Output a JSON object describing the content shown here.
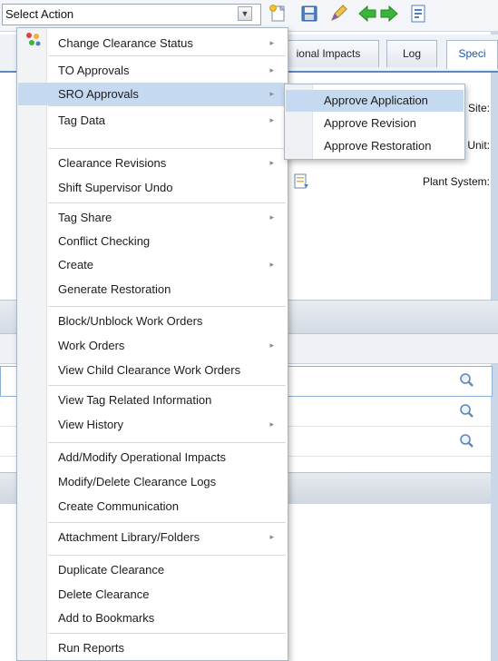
{
  "toolbar": {
    "select_action": "Select Action",
    "icons": [
      "new-icon",
      "save-icon",
      "edit-icon",
      "back-arrow-icon",
      "forward-arrow-icon",
      "report-icon"
    ]
  },
  "tabs": [
    {
      "label": "ional Impacts"
    },
    {
      "label": "Log"
    },
    {
      "label": "Speci"
    }
  ],
  "fields": {
    "site": "Site:",
    "unit": "Unit:",
    "plant_system": "Plant System:"
  },
  "menu": {
    "items": [
      {
        "label": "Change Clearance Status",
        "submenu": true
      },
      {
        "label": "TO Approvals",
        "submenu": true
      },
      {
        "label": "SRO Approvals",
        "submenu": true,
        "highlighted": true
      },
      {
        "label": "Tag Data",
        "submenu": true
      },
      {
        "label": "Clearance Revisions",
        "submenu": true
      },
      {
        "label": "Shift Supervisor Undo"
      },
      {
        "label": "Tag Share",
        "submenu": true
      },
      {
        "label": "Conflict Checking"
      },
      {
        "label": "Create",
        "submenu": true
      },
      {
        "label": "Generate Restoration"
      },
      {
        "label": "Block/Unblock Work Orders"
      },
      {
        "label": "Work Orders",
        "submenu": true
      },
      {
        "label": "View Child Clearance Work Orders"
      },
      {
        "label": "View Tag Related Information"
      },
      {
        "label": "View History",
        "submenu": true
      },
      {
        "label": "Add/Modify Operational Impacts"
      },
      {
        "label": "Modify/Delete Clearance Logs"
      },
      {
        "label": "Create Communication"
      },
      {
        "label": "Attachment Library/Folders",
        "submenu": true
      },
      {
        "label": "Duplicate Clearance"
      },
      {
        "label": "Delete Clearance"
      },
      {
        "label": "Add to Bookmarks"
      },
      {
        "label": "Run Reports"
      }
    ]
  },
  "submenu": {
    "items": [
      {
        "label": "Approve Application",
        "highlighted": true
      },
      {
        "label": "Approve Revision"
      },
      {
        "label": "Approve Restoration"
      }
    ]
  },
  "colors": {
    "highlight": "#c5d9f0",
    "tab_active_text": "#1f57a3",
    "arrow_green": "#3cb43c"
  }
}
